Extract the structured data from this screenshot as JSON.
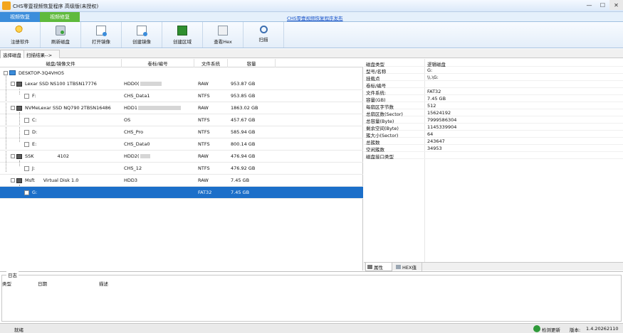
{
  "window": {
    "title": "CHS零壹视频恢复程序 高级版(未授权)",
    "minimize_glyph": "—",
    "maximize_glyph": "☐",
    "close_glyph": "✕"
  },
  "ribbon": {
    "tabs": [
      {
        "label": "视频恢复"
      },
      {
        "label": "视频修复"
      }
    ],
    "announcement_link": "CHS零壹视频恢复程序发布"
  },
  "toolbar": {
    "buttons": [
      {
        "label": "注册软件",
        "icon": "key-icon"
      },
      {
        "label": "刷新磁盘",
        "icon": "refresh-disk-icon"
      },
      {
        "label": "打开镜像",
        "icon": "open-image-icon"
      },
      {
        "label": "创建镜像",
        "icon": "create-image-icon"
      },
      {
        "label": "创建区域",
        "icon": "create-region-icon"
      },
      {
        "label": "查看Hex",
        "icon": "hex-view-icon"
      },
      {
        "label": "扫描",
        "icon": "scan-icon"
      }
    ]
  },
  "subtabs": {
    "select_disk": "选择磁盘",
    "scan_result": "扫描结果-->"
  },
  "disk_table": {
    "columns": [
      "磁盘/镜像文件",
      "卷标/编号",
      "文件系统",
      "容量"
    ],
    "root": "DESKTOP-3Q4VHO5",
    "rows": [
      {
        "name": "Lexar SSD NS100 1TBSN17776",
        "vol": "HDD0(",
        "fs": "RAW",
        "cap": "953.87 GB"
      },
      {
        "name": "F:",
        "vol": "CHS_Data1",
        "fs": "NTFS",
        "cap": "953.85 GB"
      },
      {
        "name": "NVMeLexar SSD NQ790 2TBSN16486",
        "vol": "HDD1",
        "fs": "RAW",
        "cap": "1863.02 GB"
      },
      {
        "name": "C:",
        "vol": "OS",
        "fs": "NTFS",
        "cap": "457.67 GB"
      },
      {
        "name": "D:",
        "vol": "CHS_Pro",
        "fs": "NTFS",
        "cap": "585.94 GB"
      },
      {
        "name": "E:",
        "vol": "CHS_Data0",
        "fs": "NTFS",
        "cap": "800.14 GB"
      },
      {
        "name": "SSK",
        "name_extra": "4102",
        "vol": "HDD2(",
        "fs": "RAW",
        "cap": "476.94 GB"
      },
      {
        "name": "J:",
        "vol": "CHS_12",
        "fs": "NTFS",
        "cap": "476.92 GB"
      },
      {
        "name": "Msft",
        "name_extra": "Virtual Disk    1.0",
        "vol": "HDD3",
        "fs": "RAW",
        "cap": "7.45 GB"
      },
      {
        "name": "G:",
        "vol": "",
        "fs": "FAT32",
        "cap": "7.45 GB"
      }
    ]
  },
  "properties": {
    "items": [
      {
        "k": "磁盘类型",
        "v": "逻辑磁盘"
      },
      {
        "k": "型号/名称",
        "v": "G:"
      },
      {
        "k": "挂载点",
        "v": "\\\\.\\G:"
      },
      {
        "k": "卷标/编号",
        "v": ""
      },
      {
        "k": "文件系统:",
        "v": "FAT32"
      },
      {
        "k": "容量(GB)",
        "v": "7.45 GB"
      },
      {
        "k": "每扇区字节数",
        "v": "512"
      },
      {
        "k": "总扇区数(Sector)",
        "v": "15624192"
      },
      {
        "k": "总容量(Byte)",
        "v": "7999586304"
      },
      {
        "k": "剩余空间(Byte)",
        "v": "1145339904"
      },
      {
        "k": "簇大小(Sector)",
        "v": "64"
      },
      {
        "k": "总簇数",
        "v": "243647"
      },
      {
        "k": "空闲簇数",
        "v": "34953"
      },
      {
        "k": "磁盘接口类型",
        "v": ""
      }
    ],
    "tabs": [
      "属性",
      "HEX值"
    ]
  },
  "log": {
    "title": "日志",
    "columns": [
      "类型",
      "日期",
      "描述"
    ]
  },
  "statusbar": {
    "state": "就绪",
    "check_update": "检测更新",
    "version_label": "版本:",
    "version": "1.4.20262110"
  }
}
